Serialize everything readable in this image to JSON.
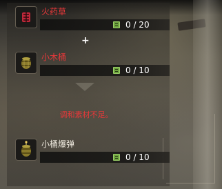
{
  "recipe": {
    "ingredients": [
      {
        "name": "火药草",
        "count": "0/20",
        "icon": "gunpowder-herb-icon",
        "insufficient": true
      },
      {
        "name": "小木桶",
        "count": "0/10",
        "icon": "small-barrel-icon",
        "insufficient": true
      }
    ],
    "combine_symbol": "+",
    "message": "调和素材不足。",
    "result": {
      "name": "小桶爆弹",
      "count": "0/10",
      "icon": "barrel-bomb-icon"
    }
  },
  "colors": {
    "insufficient_text": "#e6383a",
    "normal_text": "#ece7dc",
    "count_text": "#ffffff",
    "item_pouch_icon": "#6fa33f"
  }
}
